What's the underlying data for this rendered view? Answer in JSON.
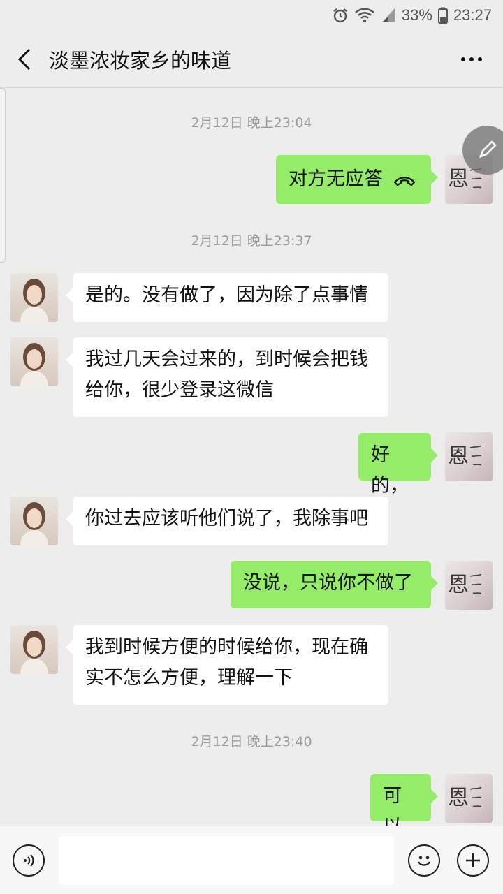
{
  "status_bar": {
    "battery_percent": "33%",
    "time": "23:27",
    "icons": [
      "alarm-icon",
      "wifi-icon",
      "signal-icon",
      "battery-icon"
    ]
  },
  "chat": {
    "title": "淡墨浓妆家乡的味道"
  },
  "timestamps": [
    "2月12日 晚上23:04",
    "2月12日 晚上23:37",
    "2月12日 晚上23:40"
  ],
  "messages": [
    {
      "side": "right",
      "text": "对方无应答",
      "icon": "hangup-phone-icon"
    },
    {
      "side": "left",
      "lines": [
        "是的。没有做了，因为除了点事情"
      ]
    },
    {
      "side": "left",
      "lines": [
        "我过几天会过来的，到时候会把钱",
        "给你，很少登录这微信"
      ]
    },
    {
      "side": "right",
      "text": "好的，"
    },
    {
      "side": "left",
      "lines": [
        "你过去应该听他们说了，我除事吧"
      ]
    },
    {
      "side": "right",
      "text": "没说，只说你不做了"
    },
    {
      "side": "left",
      "lines": [
        "我到时候方便的时候给你，现在确",
        "实不怎么方便，理解一下"
      ]
    },
    {
      "side": "right",
      "text": "可以"
    }
  ],
  "colors": {
    "background": "#ededed",
    "sent_bubble": "#95ec69",
    "received_bubble": "#ffffff",
    "timestamp_text": "#9a9a9a"
  },
  "input_bar": {
    "placeholder": ""
  }
}
